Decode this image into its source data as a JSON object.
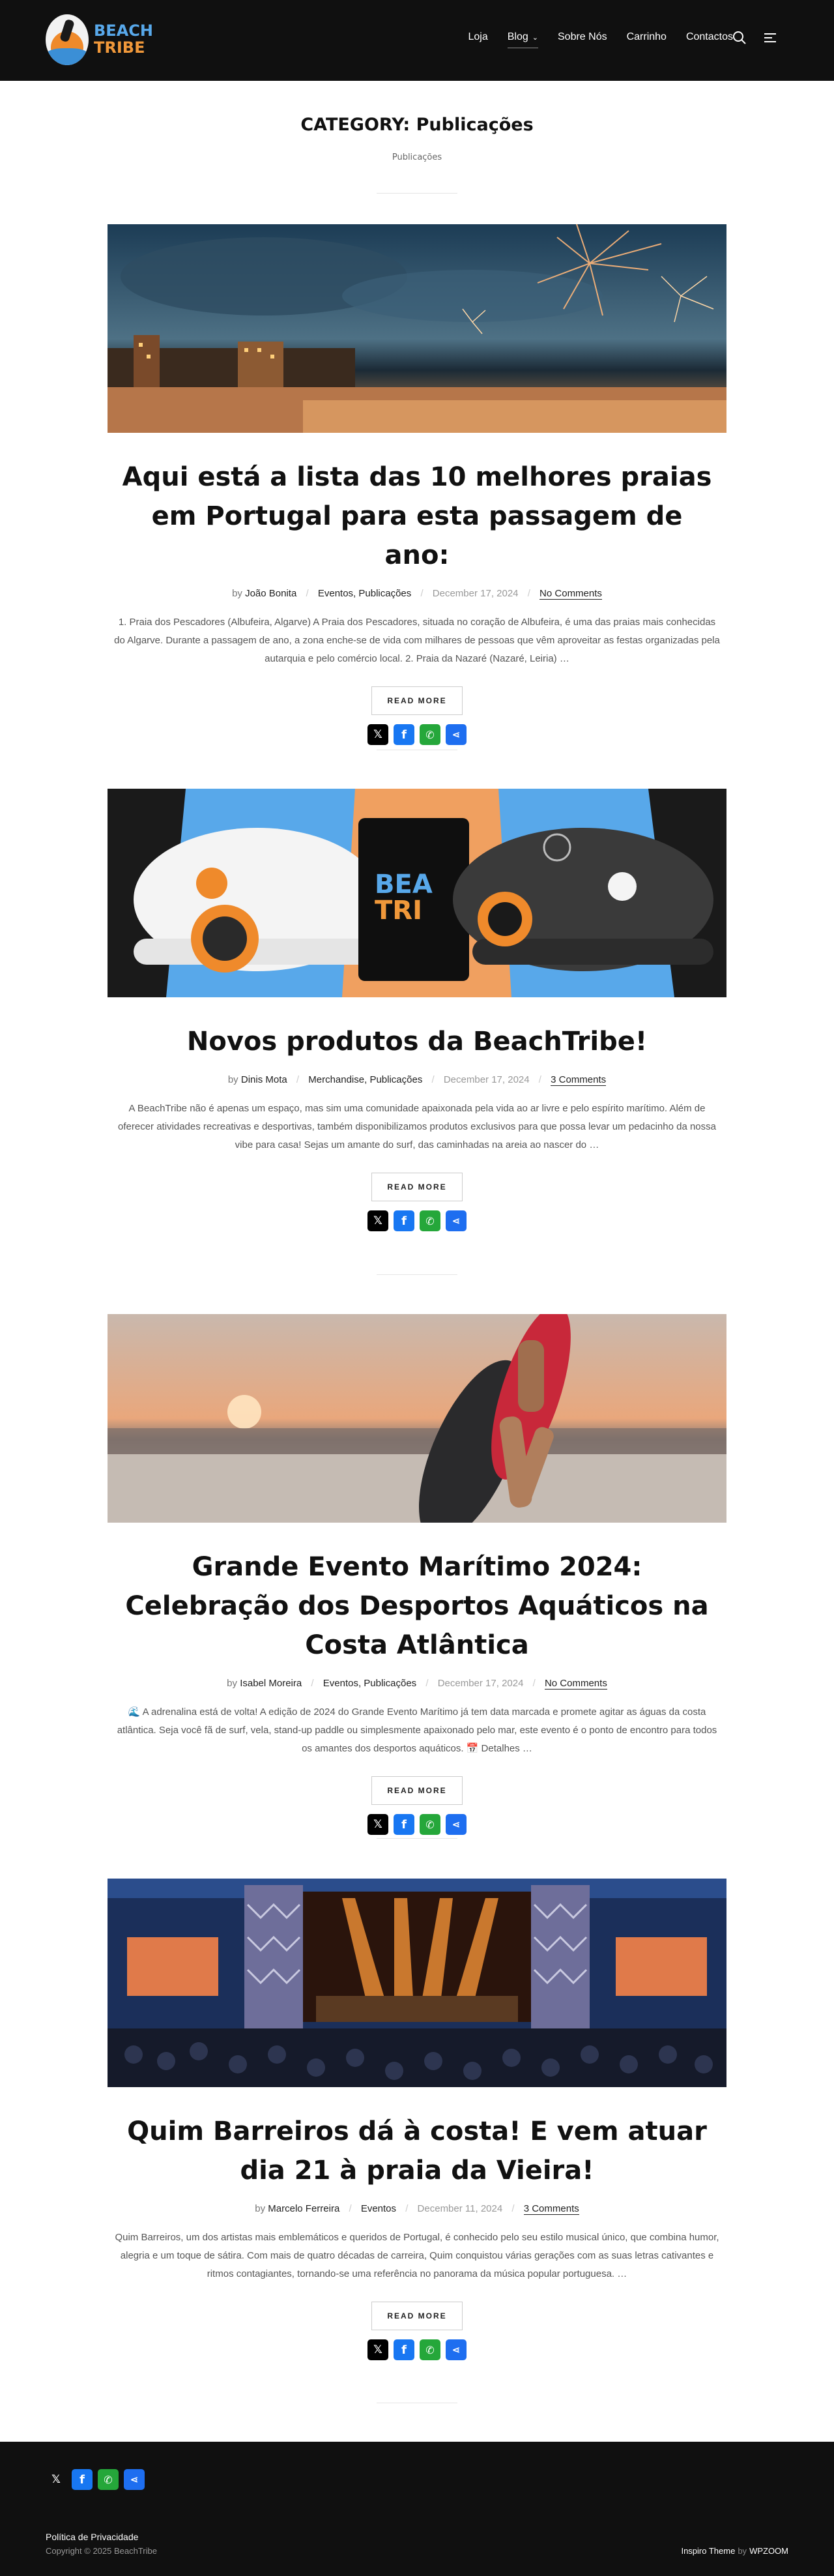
{
  "header": {
    "logo_line1": "BEACH",
    "logo_line2": "TRIBE",
    "nav": [
      "Loja",
      "Blog",
      "Sobre Nós",
      "Carrinho",
      "Contactos"
    ]
  },
  "category": {
    "title": "CATEGORY: Publicações",
    "breadcrumb": "Publicações"
  },
  "posts": [
    {
      "image": "fireworks-beach-photo",
      "title": "Aqui está a lista das 10 melhores praias em Portugal para esta passagem de ano:",
      "by": "by",
      "author": "João Bonita",
      "categories": "Eventos, Publicações",
      "date": "December 17, 2024",
      "comments": "No Comments",
      "excerpt": "1. Praia dos Pescadores (Albufeira, Algarve) A Praia dos Pescadores, situada no coração de Albufeira, é uma das praias mais conhecidas do Algarve. Durante a passagem de ano, a zona enche-se de vida com milhares de pessoas que vêm aproveitar as festas organizadas pela autarquia e pelo comércio local. 2. Praia da Nazaré (Nazaré, Leiria) …",
      "read_more": "READ MORE"
    },
    {
      "image": "merch-caps-mug-photo",
      "title": "Novos produtos da BeachTribe!",
      "by": "by",
      "author": "Dinis Mota",
      "categories": "Merchandise, Publicações",
      "date": "December 17, 2024",
      "comments": "3 Comments",
      "excerpt": "A BeachTribe não é apenas um espaço, mas sim uma comunidade apaixonada pela vida ao ar livre e pelo espírito marítimo. Além de oferecer atividades recreativas e desportivas, também disponibilizamos produtos exclusivos para que possa levar um pedacinho da nossa vibe para casa! Sejas um amante do surf, das caminhadas na areia ao nascer do …",
      "read_more": "READ MORE"
    },
    {
      "image": "surfer-sunset-photo",
      "title": "Grande Evento Marítimo 2024: Celebração dos Desportos Aquáticos na Costa Atlântica",
      "by": "by",
      "author": "Isabel Moreira",
      "categories": "Eventos, Publicações",
      "date": "December 17, 2024",
      "comments": "No Comments",
      "excerpt": "🌊 A adrenalina está de volta! A edição de 2024 do Grande Evento Marítimo já tem data marcada e promete agitar as águas da costa atlântica. Seja você fã de surf, vela, stand-up paddle ou simplesmente apaixonado pelo mar, este evento é o ponto de encontro para todos os amantes dos desportos aquáticos. 📅 Detalhes …",
      "read_more": "READ MORE"
    },
    {
      "image": "concert-stage-photo",
      "title": "Quim Barreiros dá à costa! E vem atuar dia 21 à praia da Vieira!",
      "by": "by",
      "author": "Marcelo Ferreira",
      "categories": "Eventos",
      "date": "December 11, 2024",
      "comments": "3 Comments",
      "excerpt": "Quim Barreiros, um dos artistas mais emblemáticos e queridos de Portugal, é conhecido pelo seu estilo musical único, que combina humor, alegria e um toque de sátira. Com mais de quatro décadas de carreira, Quim conquistou várias gerações com as suas letras cativantes e ritmos contagiantes, tornando-se uma referência no panorama da música popular portuguesa. …",
      "read_more": "READ MORE"
    }
  ],
  "share_icons": [
    "x-icon",
    "facebook-icon",
    "whatsapp-icon",
    "share-icon"
  ],
  "footer": {
    "privacy": "Política de Privacidade",
    "copyright": "Copyright © 2025 BeachTribe",
    "theme": "Inspiro Theme",
    "by": "by",
    "vendor": "WPZOOM"
  }
}
